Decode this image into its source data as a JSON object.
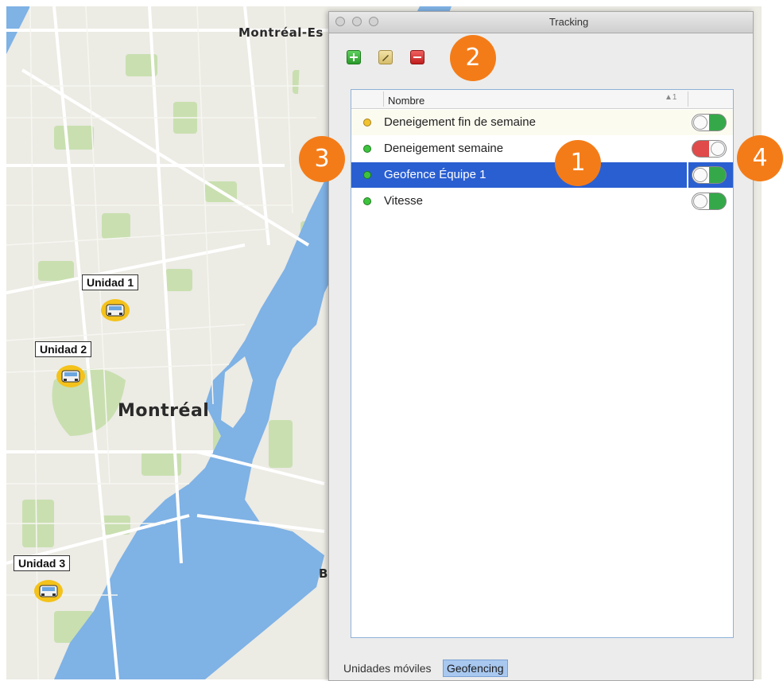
{
  "map": {
    "labels": {
      "montreal_est": "Montréal-Es",
      "montreal": "Montréal",
      "b": "B"
    },
    "units": [
      {
        "label": "Unidad 1"
      },
      {
        "label": "Unidad 2"
      },
      {
        "label": "Unidad 3"
      }
    ],
    "colors": {
      "land": "#ecebe4",
      "water": "#7fb2e5",
      "park": "#c9dfb0",
      "road": "#ffffff"
    }
  },
  "window": {
    "title": "Tracking",
    "toolbar": {
      "add_icon": "plus-icon",
      "edit_icon": "pencil-icon",
      "delete_icon": "minus-icon"
    },
    "list": {
      "column_header": "Nombre",
      "sort_indicator": "▲1",
      "rows": [
        {
          "name": "Deneigement fin de semaine",
          "status": "yellow",
          "enabled": true,
          "selected": false
        },
        {
          "name": "Deneigement semaine",
          "status": "green",
          "enabled": false,
          "selected": false
        },
        {
          "name": "Geofence Équipe 1",
          "status": "green",
          "enabled": true,
          "selected": true
        },
        {
          "name": "Vitesse",
          "status": "green",
          "enabled": true,
          "selected": false
        }
      ]
    },
    "tabs": [
      {
        "label": "Unidades móviles",
        "active": false
      },
      {
        "label": "Geofencing",
        "active": true
      }
    ]
  },
  "callouts": [
    "1",
    "2",
    "3",
    "4"
  ]
}
